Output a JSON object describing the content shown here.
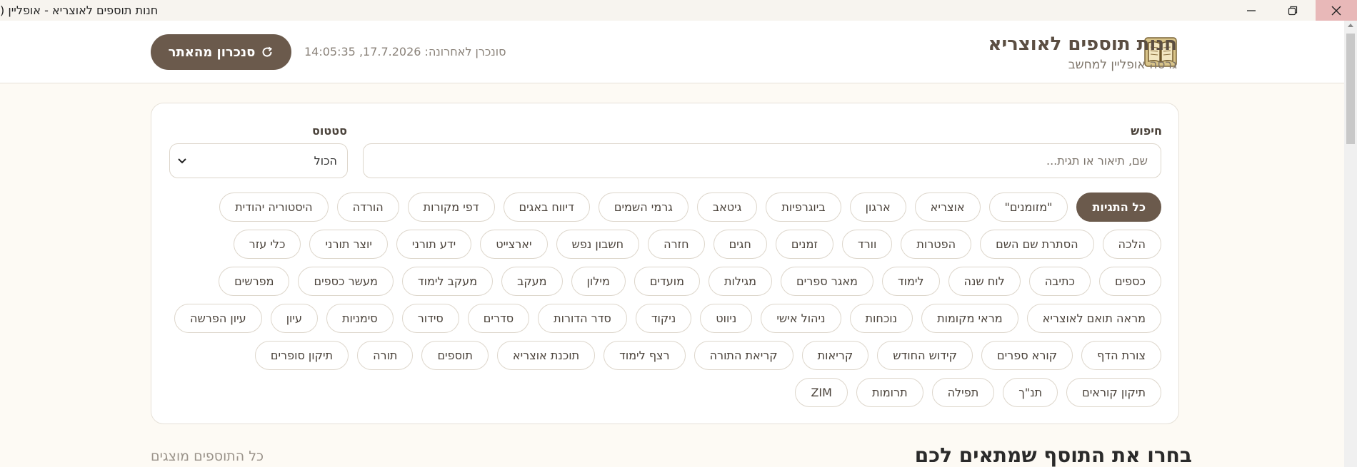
{
  "window": {
    "title": "חנות תוספים לאוצריא - אופליין (",
    "controls": [
      "minimize-icon",
      "maximize-icon",
      "close-icon"
    ]
  },
  "header": {
    "app_title": "חנות תוספים לאוצריא",
    "app_subtitle": "גרסה אופליין למחשב",
    "logo_icon": "book-icon",
    "sync_button_label": "סנכרון מהאתר",
    "sync_icon": "refresh-icon",
    "last_sync": "סונכרן לאחרונה: 17.7.2026, 14:05:35"
  },
  "filters": {
    "search_label": "חיפוש",
    "search_placeholder": "שם, תיאור או תגית...",
    "search_value": "",
    "status_label": "סטטוס",
    "status_value": "הכול"
  },
  "tags": [
    "כל התגיות",
    "\"מזומנים\"",
    "אוצריא",
    "ארגון",
    "ביוגרפיות",
    "גיטאב",
    "גרמי השמים",
    "דיווח באגים",
    "דפי מקורות",
    "הורדה",
    "היסטוריה יהודית",
    "הלכה",
    "הסתרת שם השם",
    "הפטרות",
    "וורד",
    "זמנים",
    "חגים",
    "חזרה",
    "חשבון נפש",
    "יארצייט",
    "ידע תורני",
    "יוצר תורני",
    "כלי עזר",
    "כספים",
    "כתיבה",
    "לוח שנה",
    "לימוד",
    "מאגר ספרים",
    "מגילות",
    "מועדים",
    "מילון",
    "מעקב",
    "מעקב לימוד",
    "מעשר כספים",
    "מפרשים",
    "מראה תואם לאוצריא",
    "מראי מקומות",
    "נוכחות",
    "ניהול אישי",
    "ניווט",
    "ניקוד",
    "סדר הדורות",
    "סדרים",
    "סידור",
    "סימניות",
    "עיון",
    "עיון הפרשה",
    "צורת הדף",
    "קורא ספרים",
    "קידוש החודש",
    "קריאות",
    "קריאת התורה",
    "רצף לימוד",
    "תוכנת אוצריא",
    "תוספים",
    "תורה",
    "תיקון סופרים",
    "תיקון קוראים",
    "תנ\"ך",
    "תפילה",
    "תרומות",
    "ZIM"
  ],
  "active_tag_index": 0,
  "main": {
    "section_title": "בחרו את התוסף שמתאים לכם",
    "shown_label": "כל התוספים מוצגים"
  },
  "colors": {
    "accent": "#6b5a4c",
    "background": "#fdfaf4",
    "close_hover": "#e8b8b8"
  }
}
